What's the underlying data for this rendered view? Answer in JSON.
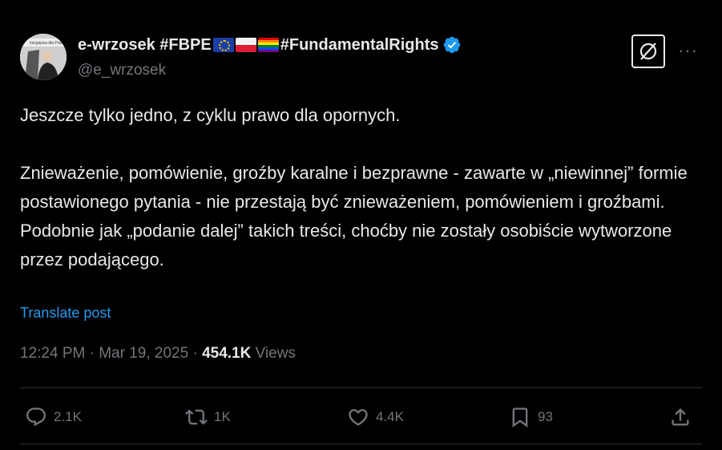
{
  "author": {
    "display_name_prefix": "e-wrzosek #FBPE",
    "display_name_suffix": "#FundamentalRights",
    "handle": "@e_wrzosek",
    "verified": true,
    "avatar_caption": "Inicjatywa dla Polski"
  },
  "post": {
    "text": "Jeszcze tylko jedno, z  cyklu prawo dla opornych.\n\nZnieważenie, pomówienie, groźby karalne i bezprawne - zawarte  w „niewinnej” formie postawionego pytania - nie przestają być znieważeniem, pomówieniem i groźbami.\nPodobnie jak „podanie dalej” takich treści, choćby nie zostały osobiście wytworzone przez podającego.",
    "translate_label": "Translate post",
    "time": "12:24 PM · Mar 19, 2025 · ",
    "views_count": "454.1K",
    "views_label": " Views"
  },
  "actions": {
    "replies": "2.1K",
    "reposts": "1K",
    "likes": "4.4K",
    "bookmarks": "93"
  },
  "colors": {
    "background": "#000000",
    "text": "#e7e9ea",
    "muted": "#71767b",
    "link": "#1d9bf0",
    "verified": "#1d9bf0"
  }
}
